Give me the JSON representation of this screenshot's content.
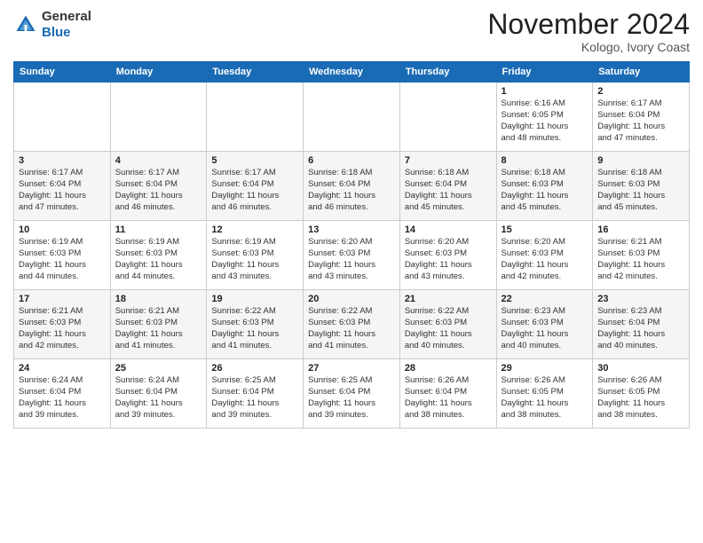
{
  "header": {
    "logo_line1": "General",
    "logo_line2": "Blue",
    "month": "November 2024",
    "location": "Kologo, Ivory Coast"
  },
  "days_of_week": [
    "Sunday",
    "Monday",
    "Tuesday",
    "Wednesday",
    "Thursday",
    "Friday",
    "Saturday"
  ],
  "weeks": [
    [
      {
        "day": "",
        "info": ""
      },
      {
        "day": "",
        "info": ""
      },
      {
        "day": "",
        "info": ""
      },
      {
        "day": "",
        "info": ""
      },
      {
        "day": "",
        "info": ""
      },
      {
        "day": "1",
        "info": "Sunrise: 6:16 AM\nSunset: 6:05 PM\nDaylight: 11 hours\nand 48 minutes."
      },
      {
        "day": "2",
        "info": "Sunrise: 6:17 AM\nSunset: 6:04 PM\nDaylight: 11 hours\nand 47 minutes."
      }
    ],
    [
      {
        "day": "3",
        "info": "Sunrise: 6:17 AM\nSunset: 6:04 PM\nDaylight: 11 hours\nand 47 minutes."
      },
      {
        "day": "4",
        "info": "Sunrise: 6:17 AM\nSunset: 6:04 PM\nDaylight: 11 hours\nand 46 minutes."
      },
      {
        "day": "5",
        "info": "Sunrise: 6:17 AM\nSunset: 6:04 PM\nDaylight: 11 hours\nand 46 minutes."
      },
      {
        "day": "6",
        "info": "Sunrise: 6:18 AM\nSunset: 6:04 PM\nDaylight: 11 hours\nand 46 minutes."
      },
      {
        "day": "7",
        "info": "Sunrise: 6:18 AM\nSunset: 6:04 PM\nDaylight: 11 hours\nand 45 minutes."
      },
      {
        "day": "8",
        "info": "Sunrise: 6:18 AM\nSunset: 6:03 PM\nDaylight: 11 hours\nand 45 minutes."
      },
      {
        "day": "9",
        "info": "Sunrise: 6:18 AM\nSunset: 6:03 PM\nDaylight: 11 hours\nand 45 minutes."
      }
    ],
    [
      {
        "day": "10",
        "info": "Sunrise: 6:19 AM\nSunset: 6:03 PM\nDaylight: 11 hours\nand 44 minutes."
      },
      {
        "day": "11",
        "info": "Sunrise: 6:19 AM\nSunset: 6:03 PM\nDaylight: 11 hours\nand 44 minutes."
      },
      {
        "day": "12",
        "info": "Sunrise: 6:19 AM\nSunset: 6:03 PM\nDaylight: 11 hours\nand 43 minutes."
      },
      {
        "day": "13",
        "info": "Sunrise: 6:20 AM\nSunset: 6:03 PM\nDaylight: 11 hours\nand 43 minutes."
      },
      {
        "day": "14",
        "info": "Sunrise: 6:20 AM\nSunset: 6:03 PM\nDaylight: 11 hours\nand 43 minutes."
      },
      {
        "day": "15",
        "info": "Sunrise: 6:20 AM\nSunset: 6:03 PM\nDaylight: 11 hours\nand 42 minutes."
      },
      {
        "day": "16",
        "info": "Sunrise: 6:21 AM\nSunset: 6:03 PM\nDaylight: 11 hours\nand 42 minutes."
      }
    ],
    [
      {
        "day": "17",
        "info": "Sunrise: 6:21 AM\nSunset: 6:03 PM\nDaylight: 11 hours\nand 42 minutes."
      },
      {
        "day": "18",
        "info": "Sunrise: 6:21 AM\nSunset: 6:03 PM\nDaylight: 11 hours\nand 41 minutes."
      },
      {
        "day": "19",
        "info": "Sunrise: 6:22 AM\nSunset: 6:03 PM\nDaylight: 11 hours\nand 41 minutes."
      },
      {
        "day": "20",
        "info": "Sunrise: 6:22 AM\nSunset: 6:03 PM\nDaylight: 11 hours\nand 41 minutes."
      },
      {
        "day": "21",
        "info": "Sunrise: 6:22 AM\nSunset: 6:03 PM\nDaylight: 11 hours\nand 40 minutes."
      },
      {
        "day": "22",
        "info": "Sunrise: 6:23 AM\nSunset: 6:03 PM\nDaylight: 11 hours\nand 40 minutes."
      },
      {
        "day": "23",
        "info": "Sunrise: 6:23 AM\nSunset: 6:04 PM\nDaylight: 11 hours\nand 40 minutes."
      }
    ],
    [
      {
        "day": "24",
        "info": "Sunrise: 6:24 AM\nSunset: 6:04 PM\nDaylight: 11 hours\nand 39 minutes."
      },
      {
        "day": "25",
        "info": "Sunrise: 6:24 AM\nSunset: 6:04 PM\nDaylight: 11 hours\nand 39 minutes."
      },
      {
        "day": "26",
        "info": "Sunrise: 6:25 AM\nSunset: 6:04 PM\nDaylight: 11 hours\nand 39 minutes."
      },
      {
        "day": "27",
        "info": "Sunrise: 6:25 AM\nSunset: 6:04 PM\nDaylight: 11 hours\nand 39 minutes."
      },
      {
        "day": "28",
        "info": "Sunrise: 6:26 AM\nSunset: 6:04 PM\nDaylight: 11 hours\nand 38 minutes."
      },
      {
        "day": "29",
        "info": "Sunrise: 6:26 AM\nSunset: 6:05 PM\nDaylight: 11 hours\nand 38 minutes."
      },
      {
        "day": "30",
        "info": "Sunrise: 6:26 AM\nSunset: 6:05 PM\nDaylight: 11 hours\nand 38 minutes."
      }
    ]
  ]
}
